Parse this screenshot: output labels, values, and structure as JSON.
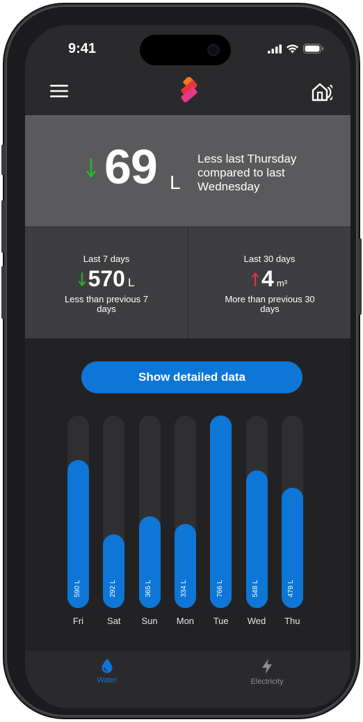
{
  "status_bar": {
    "time": "9:41"
  },
  "nav": {
    "menu_icon": "menu-icon",
    "logo_icon": "logo-icon",
    "home_icon": "smart-home-icon"
  },
  "hero": {
    "value": "69",
    "unit": "L",
    "trend": "down",
    "trend_color": "#2bb32b",
    "description": "Less last Thursday compared to last Wednesday"
  },
  "stats": [
    {
      "title": "Last 7 days",
      "value": "570",
      "unit": "L",
      "trend": "down",
      "trend_color": "#2bb32b",
      "description": "Less than previous 7 days"
    },
    {
      "title": "Last 30 days",
      "value": "4",
      "unit": "m³",
      "trend": "up",
      "trend_color": "#e8333a",
      "description": "More than previous 30 days"
    }
  ],
  "detail_button": {
    "label": "Show detailed data"
  },
  "chart_data": {
    "type": "bar",
    "categories": [
      "Fri",
      "Sat",
      "Sun",
      "Mon",
      "Tue",
      "Wed",
      "Thu"
    ],
    "values": [
      590,
      292,
      365,
      334,
      766,
      548,
      479
    ],
    "value_labels": [
      "590 L",
      "292 L",
      "365 L",
      "334 L",
      "766 L",
      "548 L",
      "479 L"
    ],
    "ylim": [
      0,
      766
    ],
    "grid": false,
    "bar_color": "#0e76d6",
    "track_color": "#2f2f31"
  },
  "tabbar": {
    "tabs": [
      {
        "label": "Water",
        "icon": "water-drop-icon",
        "active": true
      },
      {
        "label": "Electricity",
        "icon": "lightning-icon",
        "active": false
      }
    ]
  },
  "colors": {
    "accent": "#0e76d6",
    "hero_bg": "#5a5a5c",
    "stats_bg": "#3e3e40",
    "app_bg": "#222224"
  }
}
